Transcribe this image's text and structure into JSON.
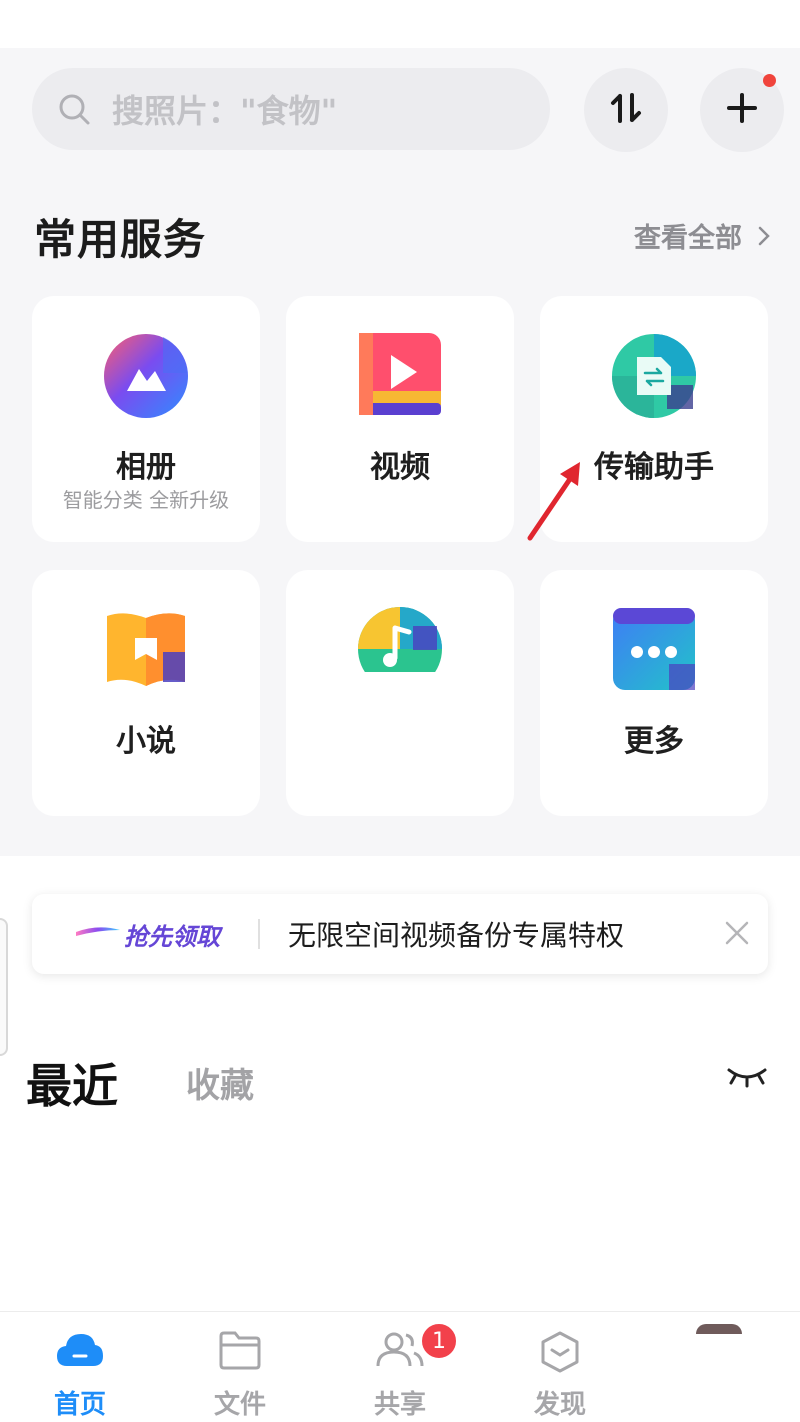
{
  "search": {
    "placeholder": "搜照片：\"食物\""
  },
  "header": {
    "sort_icon": "sort-up-down-icon",
    "add_icon": "plus-icon"
  },
  "services": {
    "title": "常用服务",
    "view_all": "查看全部",
    "cards": [
      {
        "label": "相册",
        "sub": "智能分类 全新升级",
        "icon": "album-icon"
      },
      {
        "label": "视频",
        "sub": "",
        "icon": "video-icon"
      },
      {
        "label": "传输助手",
        "sub": "",
        "icon": "transfer-assistant-icon"
      },
      {
        "label": "小说",
        "sub": "",
        "icon": "novel-icon"
      },
      {
        "label": "",
        "sub": "",
        "icon": "music-icon"
      },
      {
        "label": "更多",
        "sub": "",
        "icon": "more-icon"
      }
    ]
  },
  "banner": {
    "promo_label": "抢先领取",
    "text": "无限空间视频备份专属特权"
  },
  "tabs": {
    "recent": "最近",
    "favorites": "收藏"
  },
  "bottom_nav": [
    {
      "label": "首页",
      "icon": "home-cloud-icon",
      "active": true
    },
    {
      "label": "文件",
      "icon": "folder-icon",
      "active": false
    },
    {
      "label": "共享",
      "icon": "share-people-icon",
      "active": false
    },
    {
      "label": "发现",
      "icon": "discover-icon",
      "active": false
    }
  ],
  "share_badge": "1",
  "colors": {
    "accent": "#1e8df8",
    "badge": "#f2414b",
    "arrow": "#e0262f",
    "promo": "#6546d6"
  }
}
